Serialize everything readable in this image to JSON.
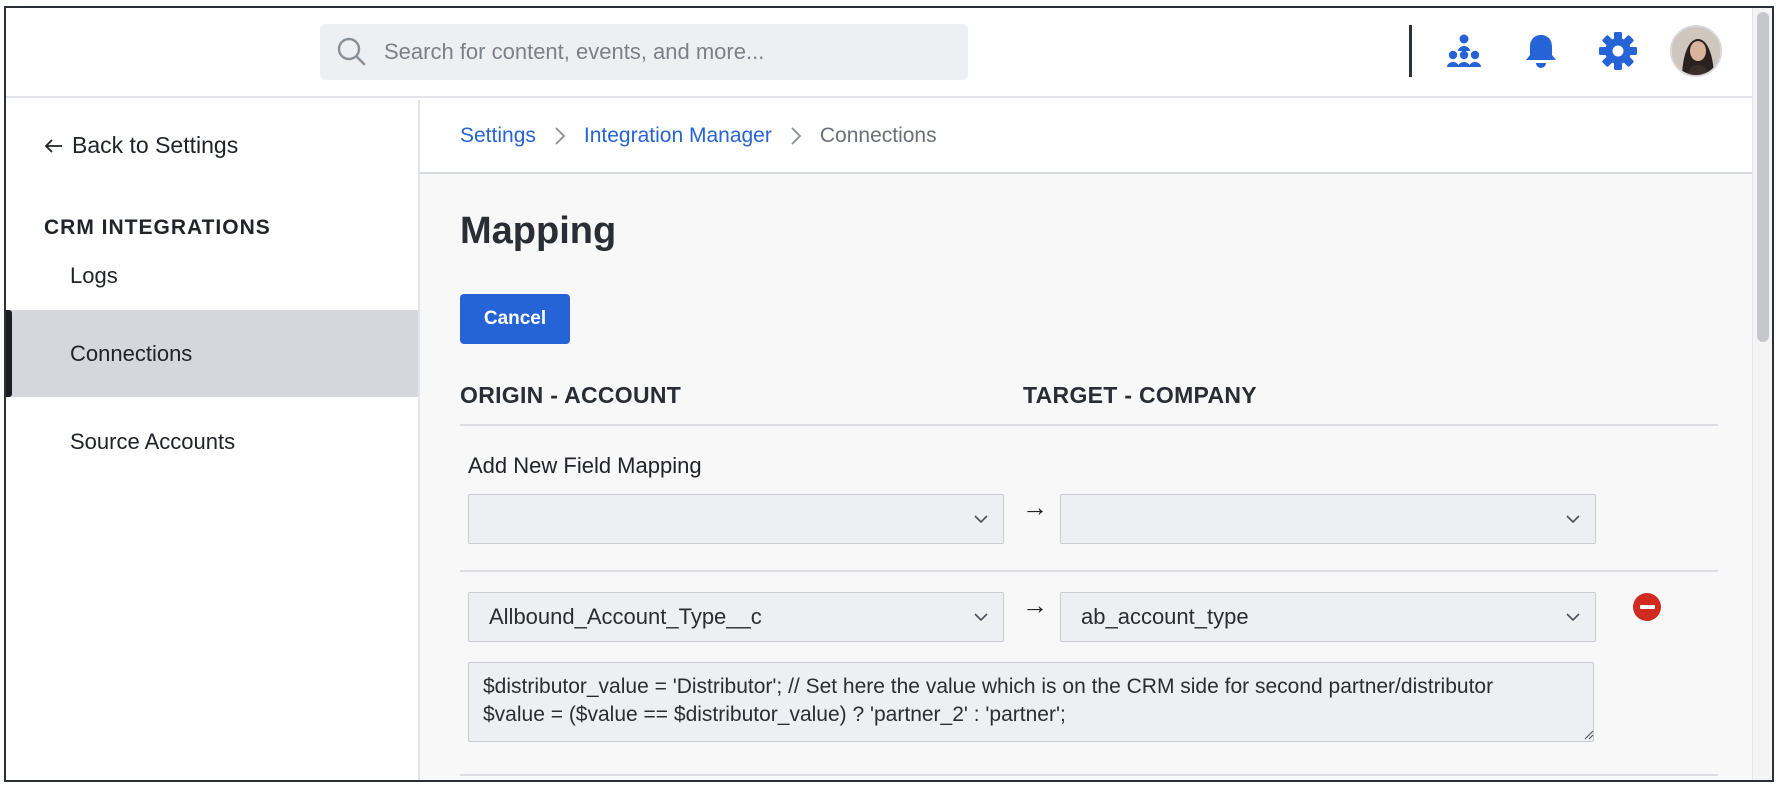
{
  "header": {
    "search_placeholder": "Search for content, events, and more...",
    "icons": [
      "search-icon",
      "org-chart-icon",
      "bell-icon",
      "gear-icon"
    ],
    "accent_color": "#2563d6"
  },
  "sidebar": {
    "back_label": "Back to Settings",
    "section_title": "CRM INTEGRATIONS",
    "items": [
      {
        "label": "Logs",
        "active": false
      },
      {
        "label": "Connections",
        "active": true
      },
      {
        "label": "Source Accounts",
        "active": false
      }
    ]
  },
  "breadcrumb": {
    "items": [
      "Settings",
      "Integration Manager",
      "Connections"
    ]
  },
  "main": {
    "title": "Mapping",
    "cancel_label": "Cancel",
    "origin_heading": "ORIGIN - ACCOUNT",
    "target_heading": "TARGET - COMPANY",
    "add_label": "Add New Field Mapping",
    "new_mapping": {
      "origin_value": "",
      "target_value": ""
    },
    "mappings": [
      {
        "origin_value": "Allbound_Account_Type__c",
        "target_value": "ab_account_type",
        "script": "$distributor_value = 'Distributor'; // Set here the value which is on the CRM side for second partner/distributor\n$value = ($value == $distributor_value) ? 'partner_2' : 'partner';"
      }
    ],
    "arrow_symbol": "→"
  }
}
